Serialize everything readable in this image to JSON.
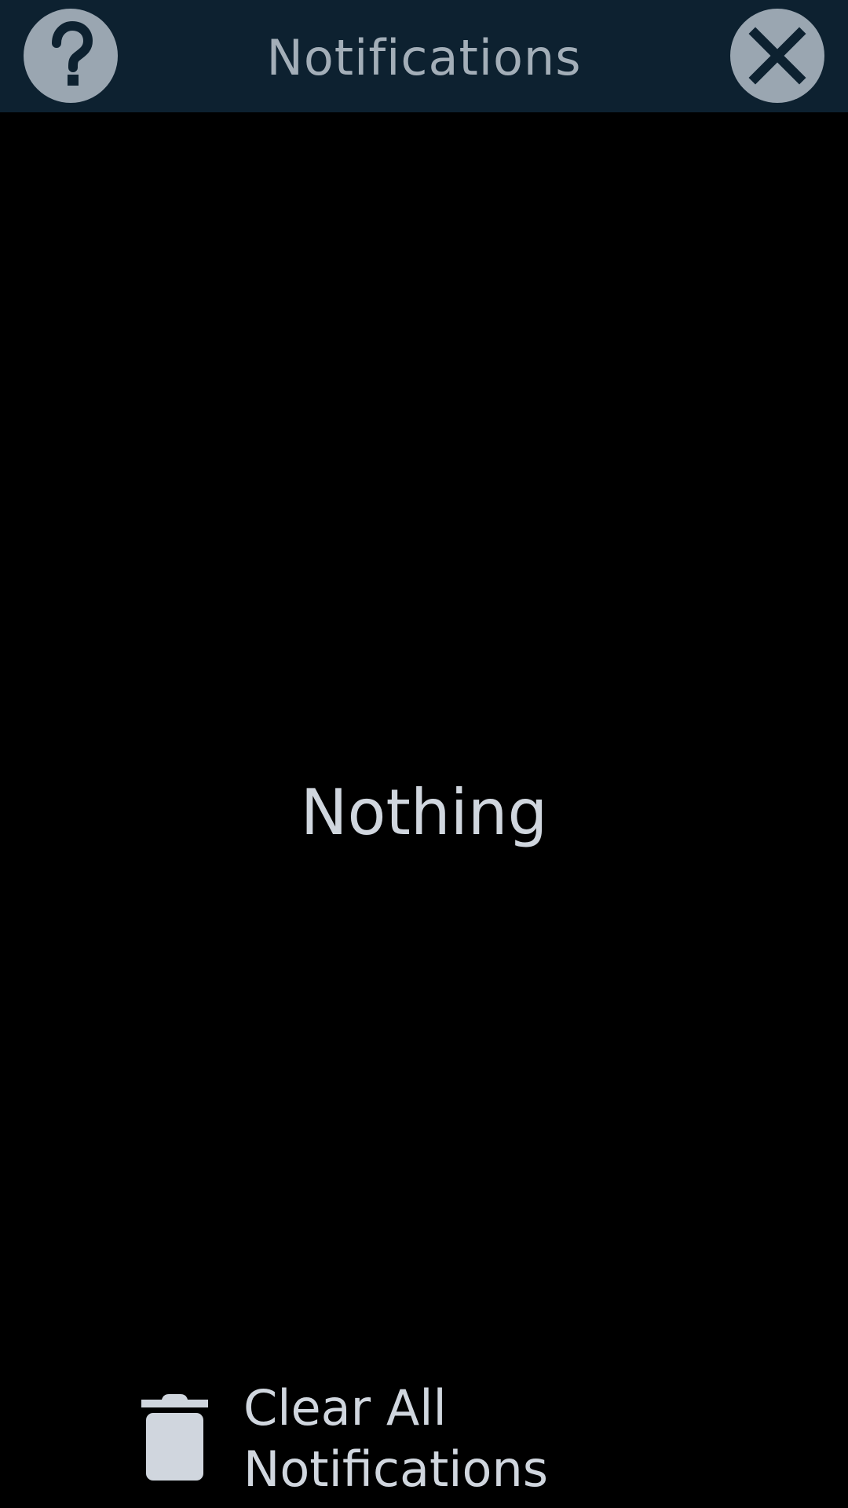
{
  "header": {
    "title": "Notifications",
    "help_icon": "help-question-icon",
    "close_icon": "close-x-icon",
    "background_color": "#0d2130",
    "button_color": "#9aa6b1"
  },
  "main": {
    "empty_text": "Nothing"
  },
  "footer": {
    "clear_label": "Clear All Notifications",
    "clear_icon": "trash-icon"
  }
}
